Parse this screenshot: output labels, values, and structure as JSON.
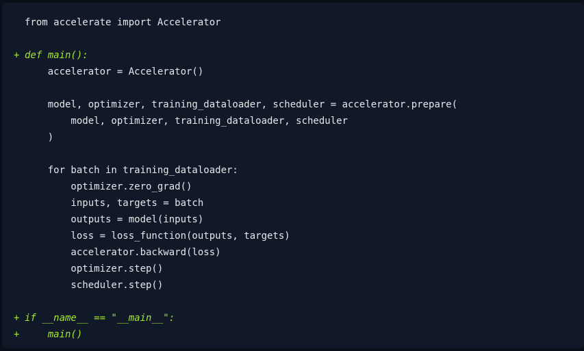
{
  "code": {
    "lines": [
      {
        "marker": "",
        "text": "from accelerate import Accelerator"
      },
      {
        "marker": "",
        "text": ""
      },
      {
        "marker": "+",
        "text": "def main():"
      },
      {
        "marker": "",
        "text": "    accelerator = Accelerator()"
      },
      {
        "marker": "",
        "text": ""
      },
      {
        "marker": "",
        "text": "    model, optimizer, training_dataloader, scheduler = accelerator.prepare("
      },
      {
        "marker": "",
        "text": "        model, optimizer, training_dataloader, scheduler"
      },
      {
        "marker": "",
        "text": "    )"
      },
      {
        "marker": "",
        "text": ""
      },
      {
        "marker": "",
        "text": "    for batch in training_dataloader:"
      },
      {
        "marker": "",
        "text": "        optimizer.zero_grad()"
      },
      {
        "marker": "",
        "text": "        inputs, targets = batch"
      },
      {
        "marker": "",
        "text": "        outputs = model(inputs)"
      },
      {
        "marker": "",
        "text": "        loss = loss_function(outputs, targets)"
      },
      {
        "marker": "",
        "text": "        accelerator.backward(loss)"
      },
      {
        "marker": "",
        "text": "        optimizer.step()"
      },
      {
        "marker": "",
        "text": "        scheduler.step()"
      },
      {
        "marker": "",
        "text": ""
      },
      {
        "marker": "+",
        "text": "if __name__ == \"__main__\":"
      },
      {
        "marker": "+",
        "text": "    main()"
      }
    ]
  },
  "colors": {
    "background": "#111827",
    "text": "#e5e7eb",
    "added": "#a3e635"
  }
}
